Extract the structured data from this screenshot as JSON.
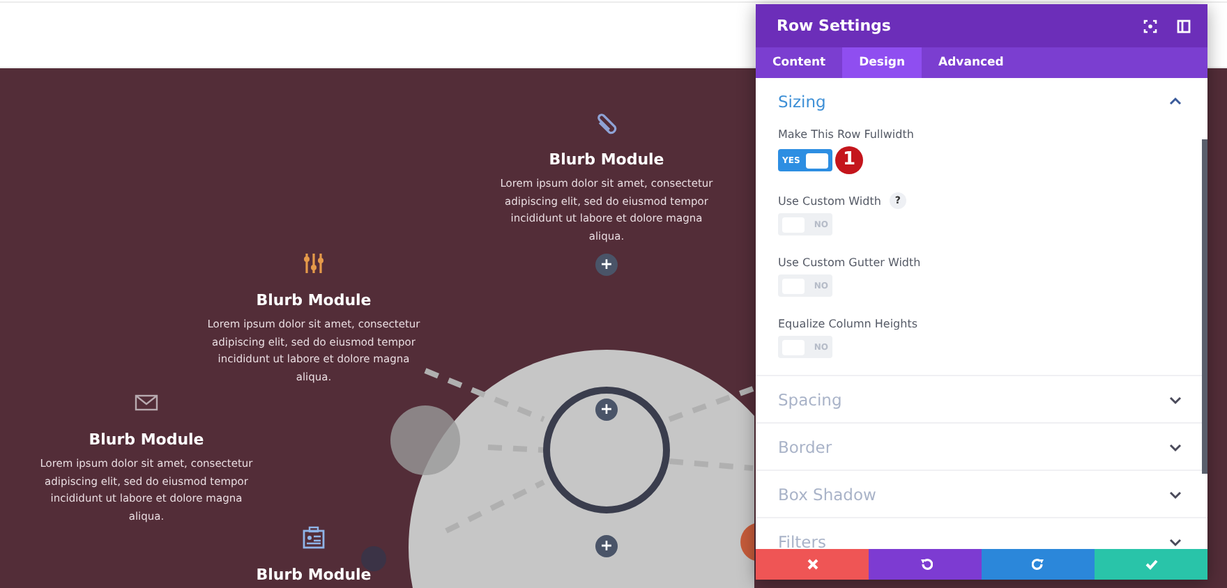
{
  "blurbs": [
    {
      "kind": "paperclip",
      "title": "Blurb Module",
      "text": "Lorem ipsum dolor sit amet, consectetur adipiscing elit, sed do eiusmod tempor incididunt ut labore et dolore magna aliqua."
    },
    {
      "kind": "sliders",
      "title": "Blurb Module",
      "text": "Lorem ipsum dolor sit amet, consectetur adipiscing elit, sed do eiusmod tempor incididunt ut labore et dolore magna aliqua."
    },
    {
      "kind": "envelope",
      "title": "Blurb Module",
      "text": "Lorem ipsum dolor sit amet, consectetur adipiscing elit, sed do eiusmod tempor incididunt ut labore et dolore magna aliqua."
    },
    {
      "kind": "badge",
      "title": "Blurb Module"
    }
  ],
  "add_buttons": [
    "+",
    "+",
    "+"
  ],
  "panel": {
    "title": "Row Settings",
    "tabs": [
      {
        "label": "Content",
        "selected": false
      },
      {
        "label": "Design",
        "selected": true
      },
      {
        "label": "Advanced",
        "selected": false
      }
    ],
    "sections": [
      {
        "title": "Sizing",
        "expanded": true,
        "settings": [
          {
            "label": "Make This Row Fullwidth",
            "on": true,
            "toggle_text": "YES",
            "callout": "1"
          },
          {
            "label": "Use Custom Width",
            "help": "?",
            "on": false,
            "toggle_text": "NO"
          },
          {
            "label": "Use Custom Gutter Width",
            "on": false,
            "toggle_text": "NO"
          },
          {
            "label": "Equalize Column Heights",
            "on": false,
            "toggle_text": "NO"
          }
        ]
      },
      {
        "title": "Spacing",
        "expanded": false
      },
      {
        "title": "Border",
        "expanded": false
      },
      {
        "title": "Box Shadow",
        "expanded": false
      },
      {
        "title": "Filters",
        "expanded": false
      }
    ],
    "footer": [
      {
        "kind": "cancel"
      },
      {
        "kind": "undo"
      },
      {
        "kind": "redo"
      },
      {
        "kind": "save"
      }
    ]
  }
}
